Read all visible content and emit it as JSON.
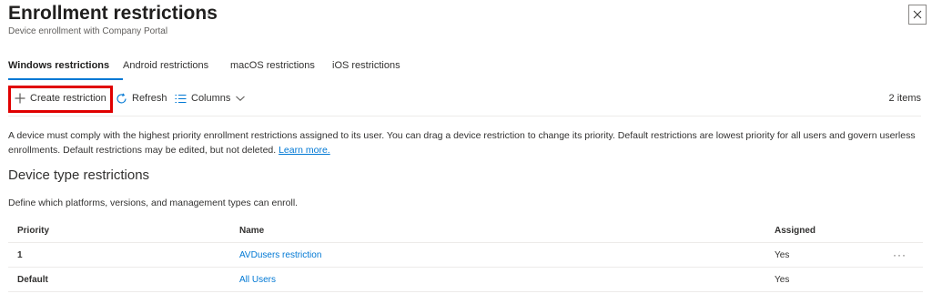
{
  "header": {
    "title": "Enrollment restrictions",
    "more_label": "···",
    "subtitle": "Device enrollment with Company Portal"
  },
  "tabs": [
    {
      "label": "Windows restrictions",
      "active": true
    },
    {
      "label": "Android restrictions",
      "active": false
    },
    {
      "label": "macOS restrictions",
      "active": false
    },
    {
      "label": "iOS restrictions",
      "active": false
    }
  ],
  "toolbar": {
    "create_label": "Create restriction",
    "refresh_label": "Refresh",
    "columns_label": "Columns",
    "items_count": "2 items"
  },
  "description": {
    "text": "A device must comply with the highest priority enrollment restrictions assigned to its user. You can drag a device restriction to change its priority. Default restrictions are lowest priority for all users and govern userless enrollments. Default restrictions may be edited, but not deleted.",
    "link": "Learn more."
  },
  "section": {
    "title": "Device type restrictions",
    "description": "Define which platforms, versions, and management types can enroll."
  },
  "table": {
    "headers": {
      "priority": "Priority",
      "name": "Name",
      "assigned": "Assigned"
    },
    "rows": [
      {
        "priority": "1",
        "name": "AVDusers restriction",
        "assigned": "Yes",
        "more": "···"
      },
      {
        "priority": "Default",
        "name": "All Users",
        "assigned": "Yes",
        "more": ""
      }
    ]
  },
  "colors": {
    "accent": "#0078d4",
    "highlight": "#e00000"
  }
}
